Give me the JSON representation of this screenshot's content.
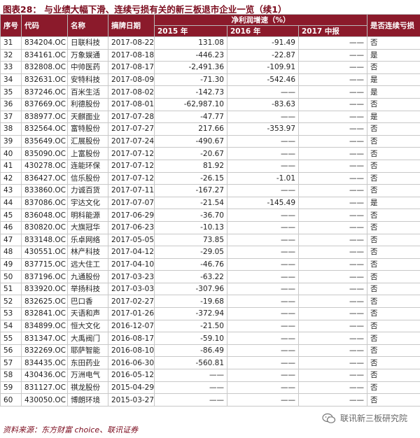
{
  "title": "图表28：  与业绩大幅下滑、连续亏损有关的新三板退市企业一览（续1）",
  "headers": {
    "seq": "序号",
    "code": "代码",
    "name": "名称",
    "date": "摘牌日期",
    "growth_group": "净利润增速（%）",
    "y2015": "2015 年",
    "y2016": "2016 年",
    "y2017": "2017 中报",
    "loss": "是否连续亏损"
  },
  "rows": [
    {
      "seq": "31",
      "code": "834204.OC",
      "name": "日联科技",
      "date": "2017-08-22",
      "v2015": "131.08",
      "v2016": "-91.49",
      "v2017": "——",
      "loss": "否"
    },
    {
      "seq": "32",
      "code": "834161.OC",
      "name": "万象娱通",
      "date": "2017-08-18",
      "v2015": "-446.23",
      "v2016": "-22.87",
      "v2017": "——",
      "loss": "是"
    },
    {
      "seq": "33",
      "code": "832808.OC",
      "name": "中帅医药",
      "date": "2017-08-17",
      "v2015": "-2,491.36",
      "v2016": "-109.91",
      "v2017": "——",
      "loss": "否"
    },
    {
      "seq": "34",
      "code": "832631.OC",
      "name": "安特科技",
      "date": "2017-08-09",
      "v2015": "-71.30",
      "v2016": "-542.46",
      "v2017": "——",
      "loss": "是"
    },
    {
      "seq": "35",
      "code": "837246.OC",
      "name": "百米生活",
      "date": "2017-08-02",
      "v2015": "-142.73",
      "v2016": "——",
      "v2017": "——",
      "loss": "是"
    },
    {
      "seq": "36",
      "code": "837669.OC",
      "name": "利德股份",
      "date": "2017-08-01",
      "v2015": "-62,987.10",
      "v2016": "-83.63",
      "v2017": "——",
      "loss": "否"
    },
    {
      "seq": "37",
      "code": "838977.OC",
      "name": "天麒面业",
      "date": "2017-07-28",
      "v2015": "-47.77",
      "v2016": "——",
      "v2017": "——",
      "loss": "是"
    },
    {
      "seq": "38",
      "code": "832564.OC",
      "name": "富特股份",
      "date": "2017-07-27",
      "v2015": "217.66",
      "v2016": "-353.97",
      "v2017": "——",
      "loss": "否"
    },
    {
      "seq": "39",
      "code": "835649.OC",
      "name": "汇展股份",
      "date": "2017-07-24",
      "v2015": "-490.67",
      "v2016": "——",
      "v2017": "——",
      "loss": "否"
    },
    {
      "seq": "40",
      "code": "835090.OC",
      "name": "上富股份",
      "date": "2017-07-12",
      "v2015": "-20.67",
      "v2016": "——",
      "v2017": "——",
      "loss": "否"
    },
    {
      "seq": "41",
      "code": "430278.OC",
      "name": "连能环保",
      "date": "2017-07-12",
      "v2015": "81.92",
      "v2016": "——",
      "v2017": "——",
      "loss": "否"
    },
    {
      "seq": "42",
      "code": "836427.OC",
      "name": "信乐股份",
      "date": "2017-07-12",
      "v2015": "-26.15",
      "v2016": "-1.01",
      "v2017": "——",
      "loss": "否"
    },
    {
      "seq": "43",
      "code": "833860.OC",
      "name": "力诚百货",
      "date": "2017-07-11",
      "v2015": "-167.27",
      "v2016": "——",
      "v2017": "——",
      "loss": "否"
    },
    {
      "seq": "44",
      "code": "837086.OC",
      "name": "宇达文化",
      "date": "2017-07-07",
      "v2015": "-21.54",
      "v2016": "-145.49",
      "v2017": "——",
      "loss": "是"
    },
    {
      "seq": "45",
      "code": "836048.OC",
      "name": "明科能源",
      "date": "2017-06-29",
      "v2015": "-36.70",
      "v2016": "——",
      "v2017": "——",
      "loss": "否"
    },
    {
      "seq": "46",
      "code": "830820.OC",
      "name": "大旗冠华",
      "date": "2017-06-23",
      "v2015": "-10.13",
      "v2016": "——",
      "v2017": "——",
      "loss": "否"
    },
    {
      "seq": "47",
      "code": "833148.OC",
      "name": "乐卓网络",
      "date": "2017-05-05",
      "v2015": "73.85",
      "v2016": "——",
      "v2017": "——",
      "loss": "否"
    },
    {
      "seq": "48",
      "code": "430551.OC",
      "name": "林产科技",
      "date": "2017-04-12",
      "v2015": "-29.05",
      "v2016": "——",
      "v2017": "——",
      "loss": "否"
    },
    {
      "seq": "49",
      "code": "837715.OC",
      "name": "远大住工",
      "date": "2017-04-10",
      "v2015": "-46.76",
      "v2016": "——",
      "v2017": "——",
      "loss": "否"
    },
    {
      "seq": "50",
      "code": "837196.OC",
      "name": "九通股份",
      "date": "2017-03-23",
      "v2015": "-63.22",
      "v2016": "——",
      "v2017": "——",
      "loss": "否"
    },
    {
      "seq": "51",
      "code": "833920.OC",
      "name": "举扬科技",
      "date": "2017-03-03",
      "v2015": "-307.96",
      "v2016": "——",
      "v2017": "——",
      "loss": "否"
    },
    {
      "seq": "52",
      "code": "832625.OC",
      "name": "巴口香",
      "date": "2017-02-27",
      "v2015": "-19.68",
      "v2016": "——",
      "v2017": "——",
      "loss": "否"
    },
    {
      "seq": "53",
      "code": "832841.OC",
      "name": "天语和声",
      "date": "2017-01-26",
      "v2015": "-372.94",
      "v2016": "——",
      "v2017": "——",
      "loss": "否"
    },
    {
      "seq": "54",
      "code": "834899.OC",
      "name": "恒大文化",
      "date": "2016-12-07",
      "v2015": "-21.50",
      "v2016": "——",
      "v2017": "——",
      "loss": "否"
    },
    {
      "seq": "55",
      "code": "831347.OC",
      "name": "大禹阀门",
      "date": "2016-08-17",
      "v2015": "-59.10",
      "v2016": "——",
      "v2017": "——",
      "loss": "否"
    },
    {
      "seq": "56",
      "code": "832269.OC",
      "name": "耶萨智能",
      "date": "2016-08-10",
      "v2015": "-86.49",
      "v2016": "——",
      "v2017": "——",
      "loss": "否"
    },
    {
      "seq": "57",
      "code": "834435.OC",
      "name": "东田药业",
      "date": "2016-06-30",
      "v2015": "-560.81",
      "v2016": "——",
      "v2017": "——",
      "loss": "否"
    },
    {
      "seq": "58",
      "code": "430436.OC",
      "name": "万洲电气",
      "date": "2016-05-12",
      "v2015": "——",
      "v2016": "——",
      "v2017": "——",
      "loss": "否"
    },
    {
      "seq": "59",
      "code": "831127.OC",
      "name": "祺龙股份",
      "date": "2015-04-29",
      "v2015": "——",
      "v2016": "——",
      "v2017": "——",
      "loss": "否"
    },
    {
      "seq": "60",
      "code": "430050.OC",
      "name": "博朗环境",
      "date": "2015-03-27",
      "v2015": "——",
      "v2016": "——",
      "v2017": "——",
      "loss": "否"
    }
  ],
  "source": "资料来源：东方财富 choice、联讯证券",
  "watermark": "联讯新三板研究院",
  "colors": {
    "header_bg": "#8b1a2b",
    "title": "#7a0a1c"
  }
}
